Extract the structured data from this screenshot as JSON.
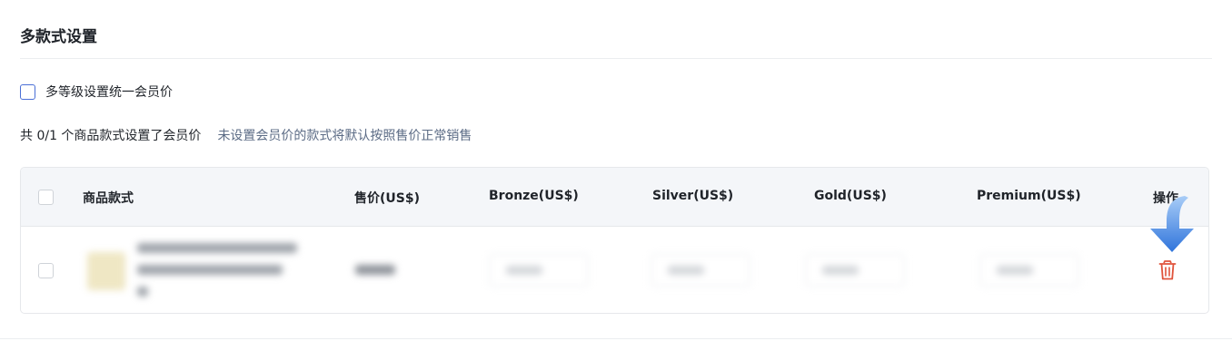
{
  "section": {
    "title": "多款式设置"
  },
  "options": {
    "unify_member_price_label": "多等级设置统一会员价"
  },
  "summary": {
    "main": "共 0/1 个商品款式设置了会员价",
    "hint": "未设置会员价的款式将默认按照售价正常销售"
  },
  "table": {
    "columns": [
      "商品款式",
      "售价(US$)",
      "Bronze(US$)",
      "Silver(US$)",
      "Gold(US$)",
      "Premium(US$)",
      "操作"
    ]
  },
  "icons": {
    "delete": "trash-icon",
    "pointer": "arrow-down-icon"
  },
  "colors": {
    "checkbox_border": "#4a6fd6",
    "hint_text": "#5b6b85",
    "delete_red": "#e0533b",
    "arrow_blue": "#3b82e6"
  }
}
